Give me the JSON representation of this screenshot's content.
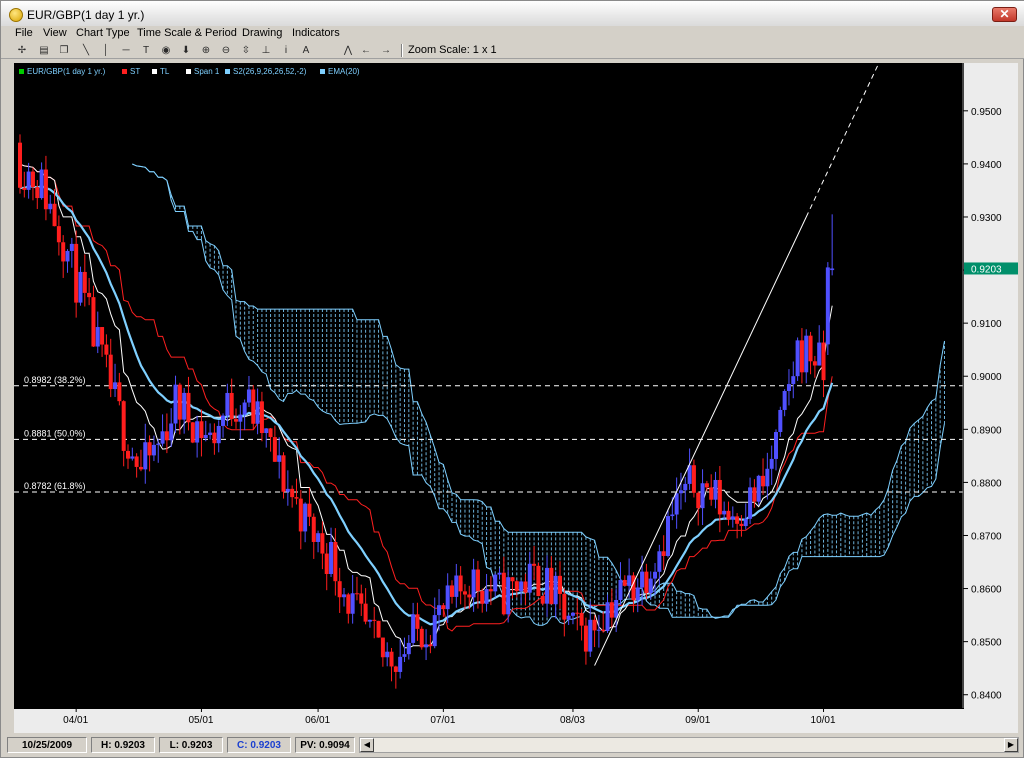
{
  "window": {
    "title": "EUR/GBP(1 day  1 yr.)",
    "close_glyph": "✕"
  },
  "menu": [
    "File",
    "View",
    "Chart Type",
    "Time Scale & Period",
    "Drawing",
    "Indicators"
  ],
  "toolbar": {
    "tools": [
      {
        "name": "crosshair-icon",
        "glyph": "✢"
      },
      {
        "name": "print-icon",
        "glyph": "▤"
      },
      {
        "name": "copy-icon",
        "glyph": "❐"
      },
      {
        "name": "trendline-icon",
        "glyph": "╲"
      },
      {
        "name": "vertical-line-icon",
        "glyph": "│"
      },
      {
        "name": "horizontal-line-icon",
        "glyph": "─"
      },
      {
        "name": "text-tool-icon",
        "glyph": "T"
      },
      {
        "name": "target-icon",
        "glyph": "◉"
      },
      {
        "name": "arrow-down-icon",
        "glyph": "⬇"
      },
      {
        "name": "zoom-in-icon",
        "glyph": "⊕"
      },
      {
        "name": "zoom-out-icon",
        "glyph": "⊖"
      },
      {
        "name": "fit-icon",
        "glyph": "⇳"
      },
      {
        "name": "anchor-icon",
        "glyph": "⊥"
      },
      {
        "name": "info-icon",
        "glyph": "i"
      },
      {
        "name": "font-icon",
        "glyph": "A"
      },
      {
        "name": "chart-wave-icon",
        "glyph": "⋀"
      },
      {
        "name": "scroll-left-icon",
        "glyph": "←"
      },
      {
        "name": "scroll-right-icon",
        "glyph": "→"
      }
    ],
    "zoom_label": "Zoom Scale: 1 x 1"
  },
  "legend": [
    {
      "label": "EUR/GBP(1 day  1 yr.)",
      "color": "#00cc00"
    },
    {
      "label": "ST",
      "color": "#ff2020"
    },
    {
      "label": "TL",
      "color": "#ffffff"
    },
    {
      "label": "Span 1",
      "color": "#ffffff"
    },
    {
      "label": "S2(26,9,26,26,52,-2)",
      "color": "#7fd0ff"
    },
    {
      "label": "EMA(20)",
      "color": "#7fd0ff"
    }
  ],
  "chart_data": {
    "type": "candlestick",
    "symbol": "EUR/GBP",
    "ylim": [
      0.8375,
      0.9575
    ],
    "yticks": [
      "0.9500",
      "0.9400",
      "0.9300",
      "0.9200",
      "0.9100",
      "0.9000",
      "0.8900",
      "0.8800",
      "0.8700",
      "0.8600",
      "0.8500",
      "0.8400"
    ],
    "xticks": [
      "04/01",
      "05/01",
      "06/01",
      "07/01",
      "08/03",
      "09/01",
      "10/01"
    ],
    "current_price": "0.9203",
    "fib_levels": [
      {
        "label": "0.8982 (38.2%)",
        "value": 0.8982
      },
      {
        "label": "0.8881 (50.0%)",
        "value": 0.8881
      },
      {
        "label": "0.8782 (61.8%)",
        "value": 0.8782
      }
    ],
    "colors": {
      "up": "#5050ff",
      "down": "#ff1e1e",
      "cloud": "#7fd0ff",
      "ema": "#7fd0ff",
      "tenkan": "#ffffff",
      "kijun": "#ff2020",
      "fib": "#ffffff"
    }
  },
  "status": {
    "date": "10/25/2009",
    "high": "H: 0.9203",
    "low": "L: 0.9203",
    "close": "C: 0.9203",
    "pv": "PV: 0.9094",
    "left_arrow": "◀",
    "right_arrow": "▶"
  }
}
